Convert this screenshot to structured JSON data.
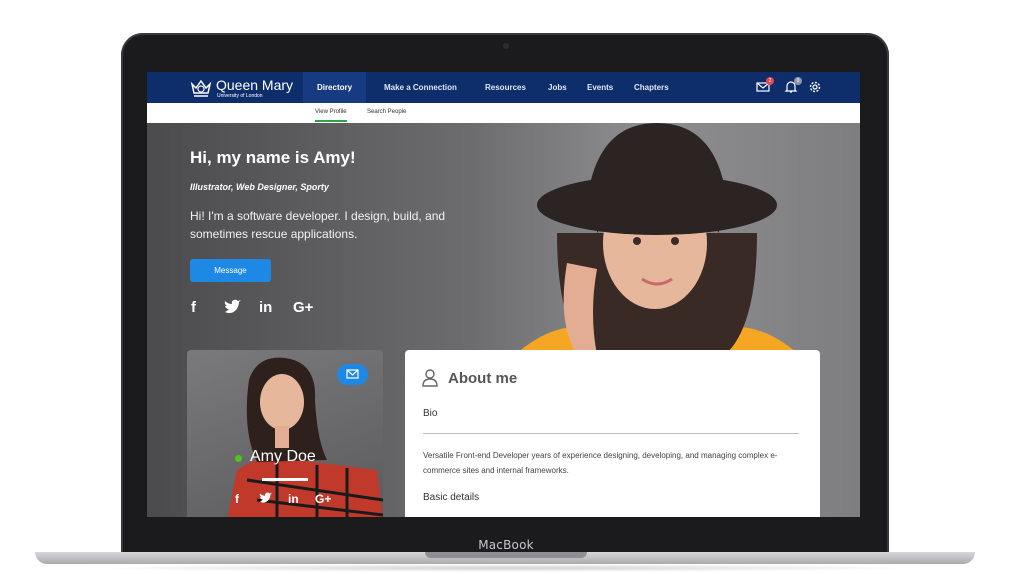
{
  "device": {
    "label": "MacBook"
  },
  "brand": {
    "name": "Queen Mary",
    "sub": "University of London"
  },
  "nav": {
    "items": [
      {
        "label": "Directory",
        "active": true
      },
      {
        "label": "Make a Connection"
      },
      {
        "label": "Resources"
      },
      {
        "label": "Jobs"
      },
      {
        "label": "Events"
      },
      {
        "label": "Chapters"
      }
    ],
    "mail_badge": "2",
    "bell_badge": "0"
  },
  "subnav": {
    "items": [
      {
        "label": "View Profile",
        "active": true
      },
      {
        "label": "Search People"
      }
    ]
  },
  "hero": {
    "title": "Hi, my name is Amy!",
    "tagline": "Illustrator, Web Designer, Sporty",
    "intro": "Hi! I'm a software developer. I design, build, and sometimes rescue applications.",
    "message_button": "Message",
    "social": {
      "facebook": "f",
      "linkedin": "in",
      "google": "G+"
    }
  },
  "profile_card": {
    "name": "Amy Doe",
    "social": {
      "facebook": "f",
      "linkedin": "in",
      "google": "G+"
    }
  },
  "about": {
    "title": "About me",
    "bio_label": "Bio",
    "bio_text": "Versatile Front-end Developer years of experience designing, developing, and managing complex e-commerce sites and internal frameworks.",
    "basic_details_label": "Basic details"
  },
  "colors": {
    "nav_bg": "#0d2e6b",
    "nav_active_bg": "#173b80",
    "accent_blue": "#1e88e5",
    "online_green": "#52c41a",
    "active_tab_underline": "#2ea34a",
    "badge_red": "#e8454f"
  }
}
